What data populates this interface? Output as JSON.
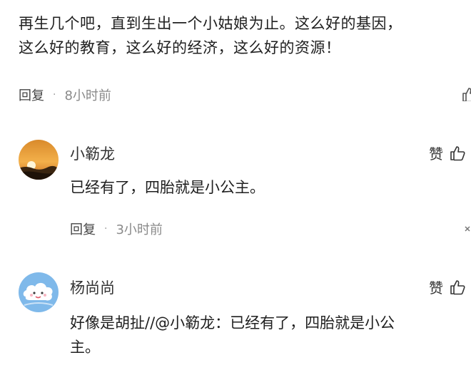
{
  "root_comment": {
    "text_line1": "再生几个吧，直到生出一个小姑娘为止。这么好的基因，",
    "text_line2": "这么好的教育，这么好的经济，这么好的资源！",
    "reply_label": "回复",
    "separator": "·",
    "time": "8小时前"
  },
  "replies": [
    {
      "username": "小簕龙",
      "like_label": "赞",
      "text": "已经有了，四胎就是小公主。",
      "reply_label": "回复",
      "separator": "·",
      "time": "3小时前",
      "avatar_icon": "sunset-avatar-icon"
    },
    {
      "username": "杨尚尚",
      "like_label": "赞",
      "text_line1": "好像是胡扯//@小簕龙：已经有了，四胎就是小公",
      "text_line2": "主。",
      "avatar_icon": "cloud-face-avatar-icon"
    }
  ],
  "colors": {
    "text": "#1f1f1f",
    "meta": "#8a8a8a",
    "avatar_sunset_sky": "#f0a040",
    "avatar_cloud_bg": "#7fb9ea"
  }
}
